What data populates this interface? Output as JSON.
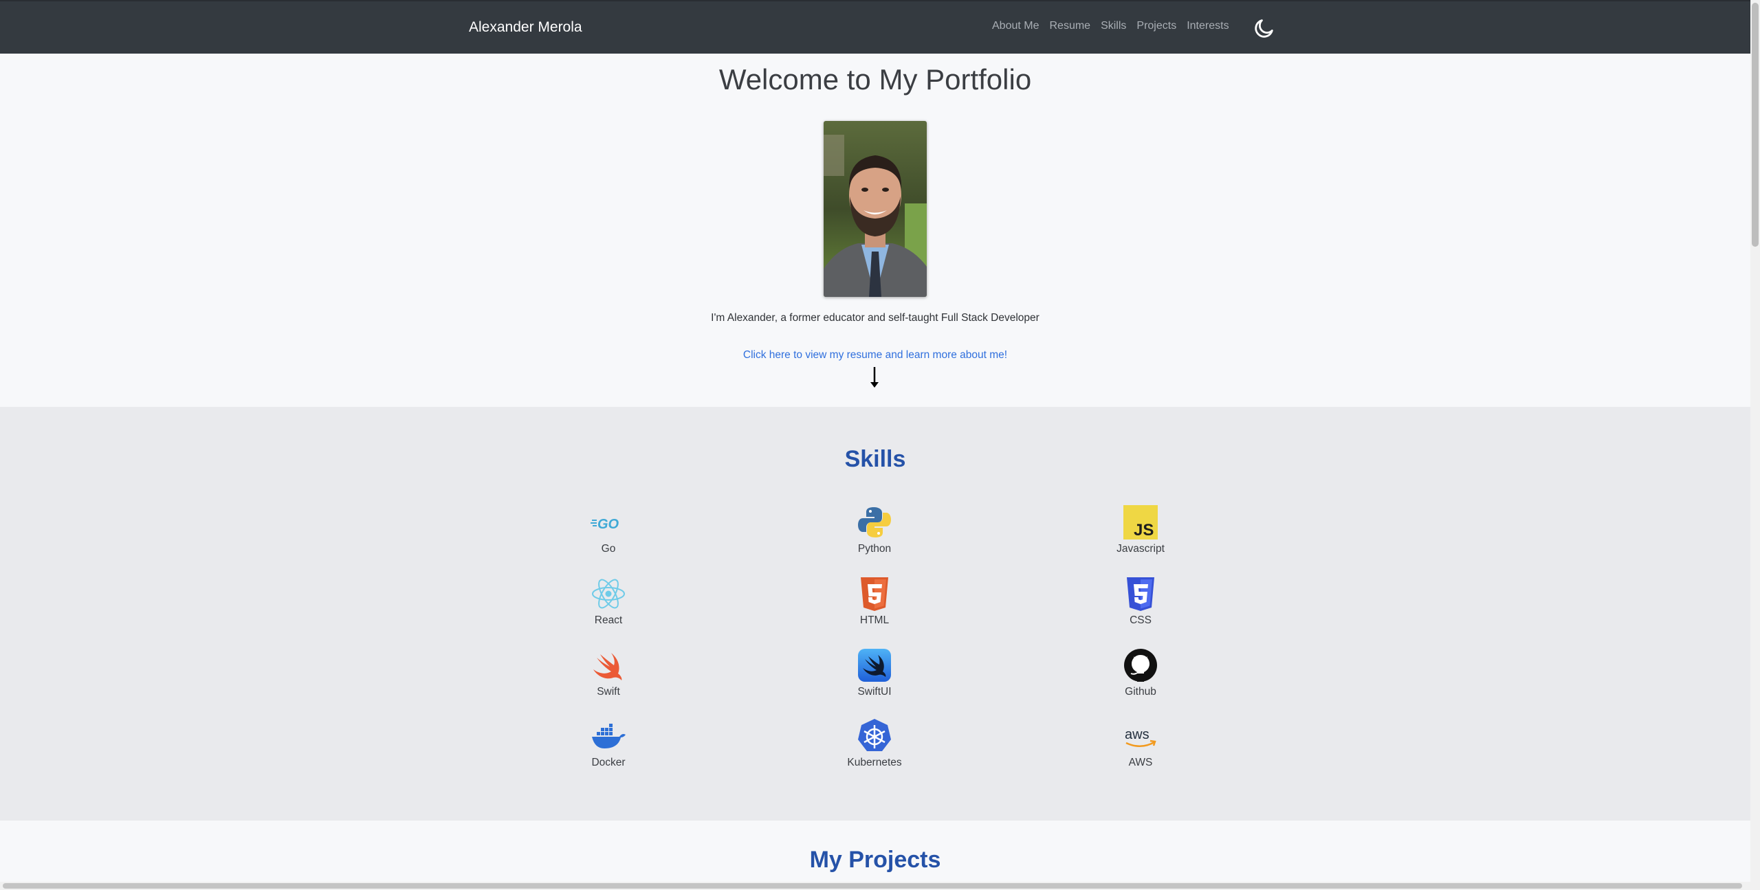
{
  "nav": {
    "brand": "Alexander Merola",
    "links": [
      "About Me",
      "Resume",
      "Skills",
      "Projects",
      "Interests"
    ],
    "theme_toggle_icon": "moon-icon"
  },
  "hero": {
    "title": "Welcome to My Portfolio",
    "tagline": "I'm Alexander, a former educator and self-taught Full Stack Developer",
    "resume_link": "Click here to view my resume and learn more about me!",
    "arrow_icon": "arrow-down-icon"
  },
  "skills": {
    "title": "Skills",
    "items": [
      {
        "label": "Go",
        "icon": "go-icon"
      },
      {
        "label": "Python",
        "icon": "python-icon"
      },
      {
        "label": "Javascript",
        "icon": "javascript-icon"
      },
      {
        "label": "React",
        "icon": "react-icon"
      },
      {
        "label": "HTML",
        "icon": "html5-icon"
      },
      {
        "label": "CSS",
        "icon": "css3-icon"
      },
      {
        "label": "Swift",
        "icon": "swift-icon"
      },
      {
        "label": "SwiftUI",
        "icon": "swiftui-icon"
      },
      {
        "label": "Github",
        "icon": "github-icon"
      },
      {
        "label": "Docker",
        "icon": "docker-icon"
      },
      {
        "label": "Kubernetes",
        "icon": "kubernetes-icon"
      },
      {
        "label": "AWS",
        "icon": "aws-icon"
      }
    ]
  },
  "projects": {
    "title": "My Projects"
  },
  "colors": {
    "navbar": "#343a40",
    "accent_blue": "#2552a8",
    "link_blue": "#2f6fdd",
    "hero_bg": "#f7f8fa",
    "skills_bg": "#e9eaed"
  }
}
